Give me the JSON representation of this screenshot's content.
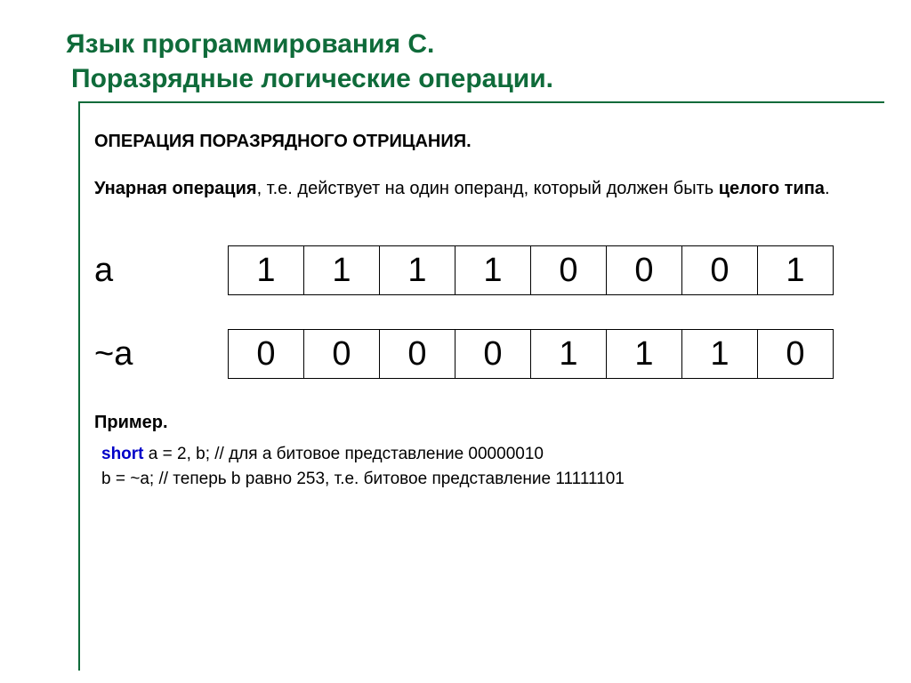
{
  "title": {
    "line1": "Язык программирования С.",
    "line2": "Поразрядные логические операции."
  },
  "section": "ОПЕРАЦИЯ ПОРАЗРЯДНОГО ОТРИЦАНИЯ.",
  "para": {
    "lead_bold": "Унарная операция",
    "mid": ", т.е. действует на один операнд, который должен быть ",
    "tail_bold": "целого типа",
    "end": "."
  },
  "rows": {
    "a_label": "a",
    "a_bits": [
      "1",
      "1",
      "1",
      "1",
      "0",
      "0",
      "0",
      "1"
    ],
    "nota_label": "~a",
    "nota_bits": [
      "0",
      "0",
      "0",
      "0",
      "1",
      "1",
      "1",
      "0"
    ]
  },
  "example_label": "Пример.",
  "code": {
    "kw_short": "short",
    "line1_rest": " a = 2, b; // для a битовое представление 00000010",
    "line2": "b = ~a;            // теперь b равно 253, т.е. битовое представление 11111101"
  }
}
